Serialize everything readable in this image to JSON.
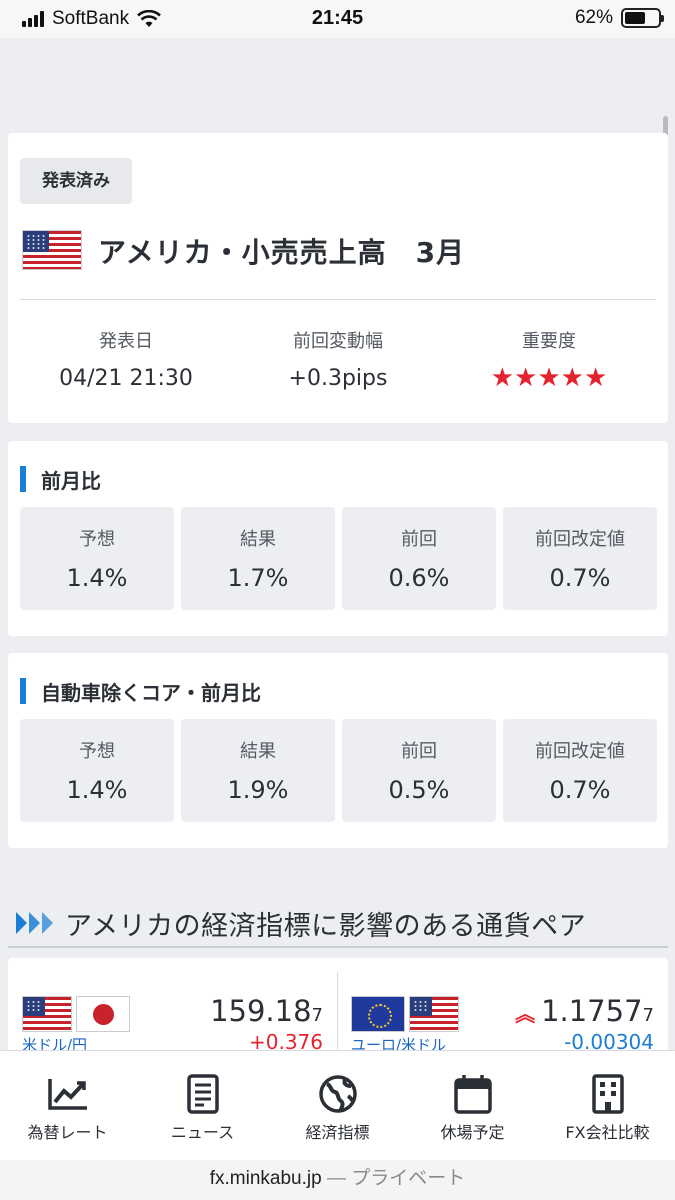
{
  "status_bar": {
    "carrier": "SoftBank",
    "time": "21:45",
    "battery": "62%",
    "battery_level": 0.62
  },
  "event": {
    "badge": "発表済み",
    "title": "アメリカ・小売売上高　3月",
    "release_date_label": "発表日",
    "release_date": "04/21 21:30",
    "prev_move_label": "前回変動幅",
    "prev_move": "+0.3pips",
    "importance_label": "重要度",
    "importance_stars": "★★★★★",
    "importance_rating": 5
  },
  "sections": [
    {
      "title": "前月比",
      "cells": [
        {
          "label": "予想",
          "value": "1.4%"
        },
        {
          "label": "結果",
          "value": "1.7%"
        },
        {
          "label": "前回",
          "value": "0.6%"
        },
        {
          "label": "前回改定値",
          "value": "0.7%"
        }
      ]
    },
    {
      "title": "自動車除くコア・前月比",
      "cells": [
        {
          "label": "予想",
          "value": "1.4%"
        },
        {
          "label": "結果",
          "value": "1.9%"
        },
        {
          "label": "前回",
          "value": "0.5%"
        },
        {
          "label": "前回改定値",
          "value": "0.7%"
        }
      ]
    }
  ],
  "related": {
    "title": "アメリカの経済指標に影響のある通貨ペア",
    "pairs": [
      {
        "name": "米ドル/円",
        "price_main": "159.18",
        "price_small": "7",
        "change": "+0.376",
        "change_color": "#e5232e"
      },
      {
        "name": "ユーロ/米ドル",
        "price_main": "1.1757",
        "price_small": "7",
        "change": "-0.00304",
        "change_color": "#1a7fd4",
        "trend": "up-double-arrow"
      }
    ]
  },
  "tabs": [
    {
      "label": "為替レート",
      "icon": "chart-line-icon"
    },
    {
      "label": "ニュース",
      "icon": "document-icon"
    },
    {
      "label": "経済指標",
      "icon": "globe-icon"
    },
    {
      "label": "休場予定",
      "icon": "calendar-icon"
    },
    {
      "label": "FX会社比較",
      "icon": "building-icon"
    }
  ],
  "url_bar": {
    "domain": "fx.minkabu.jp",
    "separator": " — ",
    "mode": "プライベート"
  },
  "colors": {
    "accent": "#1a7fd4",
    "star": "#e5232e",
    "positive": "#e5232e",
    "negative": "#1a7fd4"
  }
}
